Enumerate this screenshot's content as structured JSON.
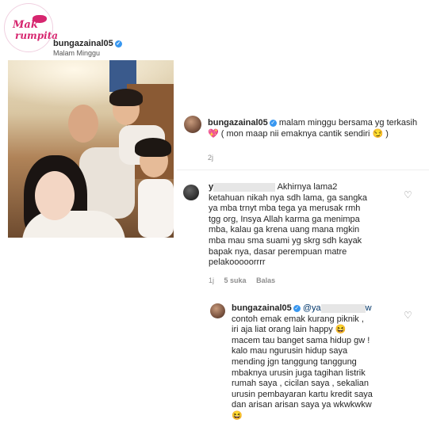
{
  "brand": {
    "line1": "Mak",
    "line2": "rumpita"
  },
  "post": {
    "username": "bungazainal05",
    "location": "Malam Minggu"
  },
  "caption": {
    "username": "bungazainal05",
    "text": "malam minggu bersama yg terkasih 💖 ( mon maap nii emaknya cantik sendiri 😏 )",
    "time": "2j"
  },
  "comment1": {
    "username_visible": "y",
    "lines": [
      "Akhirnya lama2",
      "ketahuan nikah nya sdh lama, ga sangka",
      "ya mba trnyt mba tega ya merusak rmh",
      "tgg org, Insya Allah karma ga menimpa",
      "mba, kalau ga krena uang mana mgkin",
      "mba mau sma suami yg skrg sdh kayak",
      "bapak nya, dasar perempuan matre",
      "pelakooooorrrr"
    ],
    "time": "1j",
    "likes": "5 suka",
    "reply": "Balas"
  },
  "reply": {
    "username": "bungazainal05",
    "mention_prefix": "@ya",
    "mention_suffix": "w",
    "lines": [
      "contoh emak emak kurang piknik ,",
      "iri aja liat orang lain happy 😆",
      "macem tau banget sama hidup gw !",
      "kalo mau ngurusin hidup saya",
      "mending jgn tanggung tanggung",
      "mbaknya urusin juga tagihan listrik",
      "rumah saya , cicilan saya , sekalian",
      "urusin pembayaran kartu kredit saya",
      "dan arisan arisan saya ya wkwkwkw",
      "😆"
    ]
  },
  "icons": {
    "heart": "heart-outline-icon",
    "verified": "verified-badge-icon"
  }
}
